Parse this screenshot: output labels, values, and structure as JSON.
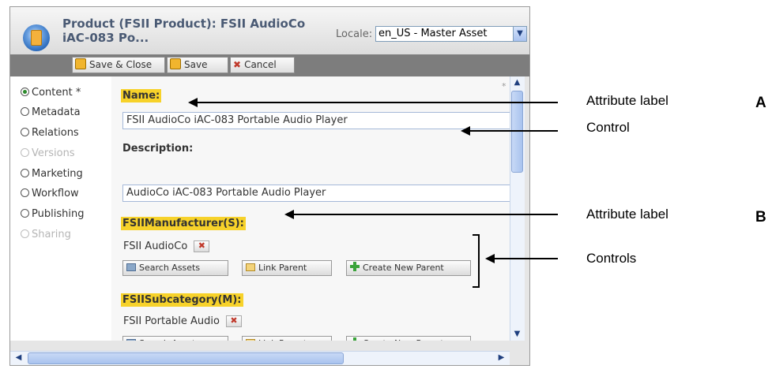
{
  "window": {
    "title": "Product (FSII Product): FSII AudioCo iAC-083 Po...",
    "locale_label": "Locale:",
    "locale_value": "en_US - Master Asset"
  },
  "toolbar": {
    "save_close": "Save & Close",
    "save": "Save",
    "cancel": "Cancel"
  },
  "nav": {
    "items": [
      {
        "label": "Content *",
        "state": "selected"
      },
      {
        "label": "Metadata",
        "state": "enabled"
      },
      {
        "label": "Relations",
        "state": "enabled"
      },
      {
        "label": "Versions",
        "state": "disabled"
      },
      {
        "label": "Marketing",
        "state": "enabled"
      },
      {
        "label": "Workflow",
        "state": "enabled"
      },
      {
        "label": "Publishing",
        "state": "enabled"
      },
      {
        "label": "Sharing",
        "state": "disabled"
      }
    ]
  },
  "form": {
    "required_marker": "*",
    "name_label": "Name:",
    "name_value": "FSII AudioCo iAC-083 Portable Audio Player",
    "description_label": "Description:",
    "description_value": "AudioCo iAC-083 Portable Audio Player",
    "manufacturer_label": "FSIIManufacturer(S):",
    "manufacturer_value": "FSII AudioCo",
    "subcategory_label": "FSIISubcategory(M):",
    "subcategory_value": "FSII Portable Audio",
    "search_assets": "Search Assets",
    "link_parent": "Link Parent",
    "create_new_parent": "Create New Parent"
  },
  "callouts": {
    "attribute_label_a": "Attribute label",
    "control": "Control",
    "attribute_label_b": "Attribute label",
    "controls": "Controls",
    "marker_a": "A",
    "marker_b": "B"
  }
}
